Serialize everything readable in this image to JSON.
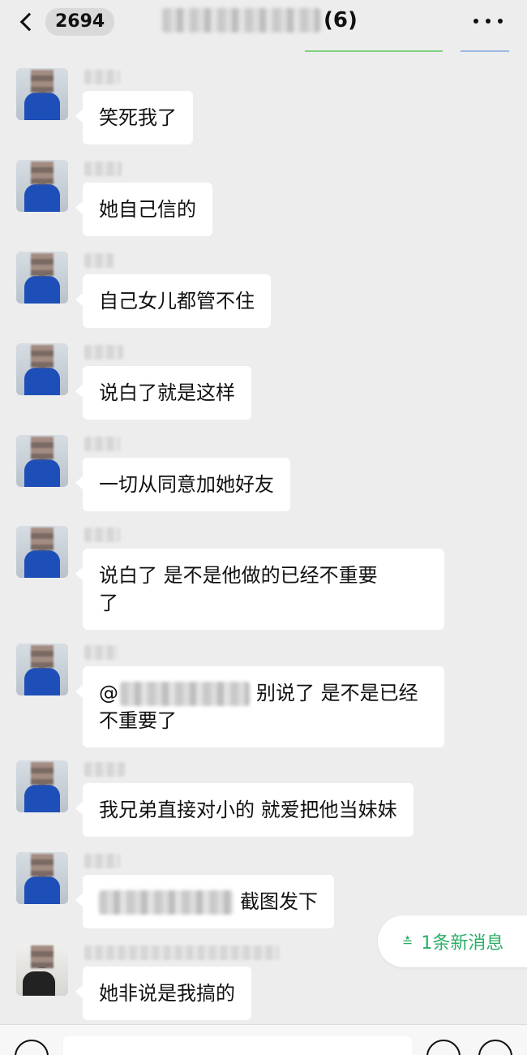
{
  "header": {
    "unread_count": "2694",
    "member_count": "(6)"
  },
  "messages": [
    {
      "text": "笑死我了"
    },
    {
      "text": "她自己信的"
    },
    {
      "text": "自己女儿都管不住"
    },
    {
      "text": "说白了就是这样"
    },
    {
      "text": "一切从同意加她好友"
    },
    {
      "line1": "说白了   是不是他做的已经不重要",
      "line2": "了"
    },
    {
      "at": "@",
      "line1": "别说了  是不是已经",
      "line2": "不重要了"
    },
    {
      "text": "我兄弟直接对小的 就爱把他当妹妹"
    },
    {
      "text": "截图发下"
    },
    {
      "text": "她非说是我搞的"
    }
  ],
  "new_messages": {
    "label": "1条新消息",
    "icon": "double-chevron-down-icon",
    "color": "#2aae67"
  },
  "colors": {
    "background": "#ededed",
    "bubble": "#ffffff",
    "accent": "#2aae67"
  }
}
